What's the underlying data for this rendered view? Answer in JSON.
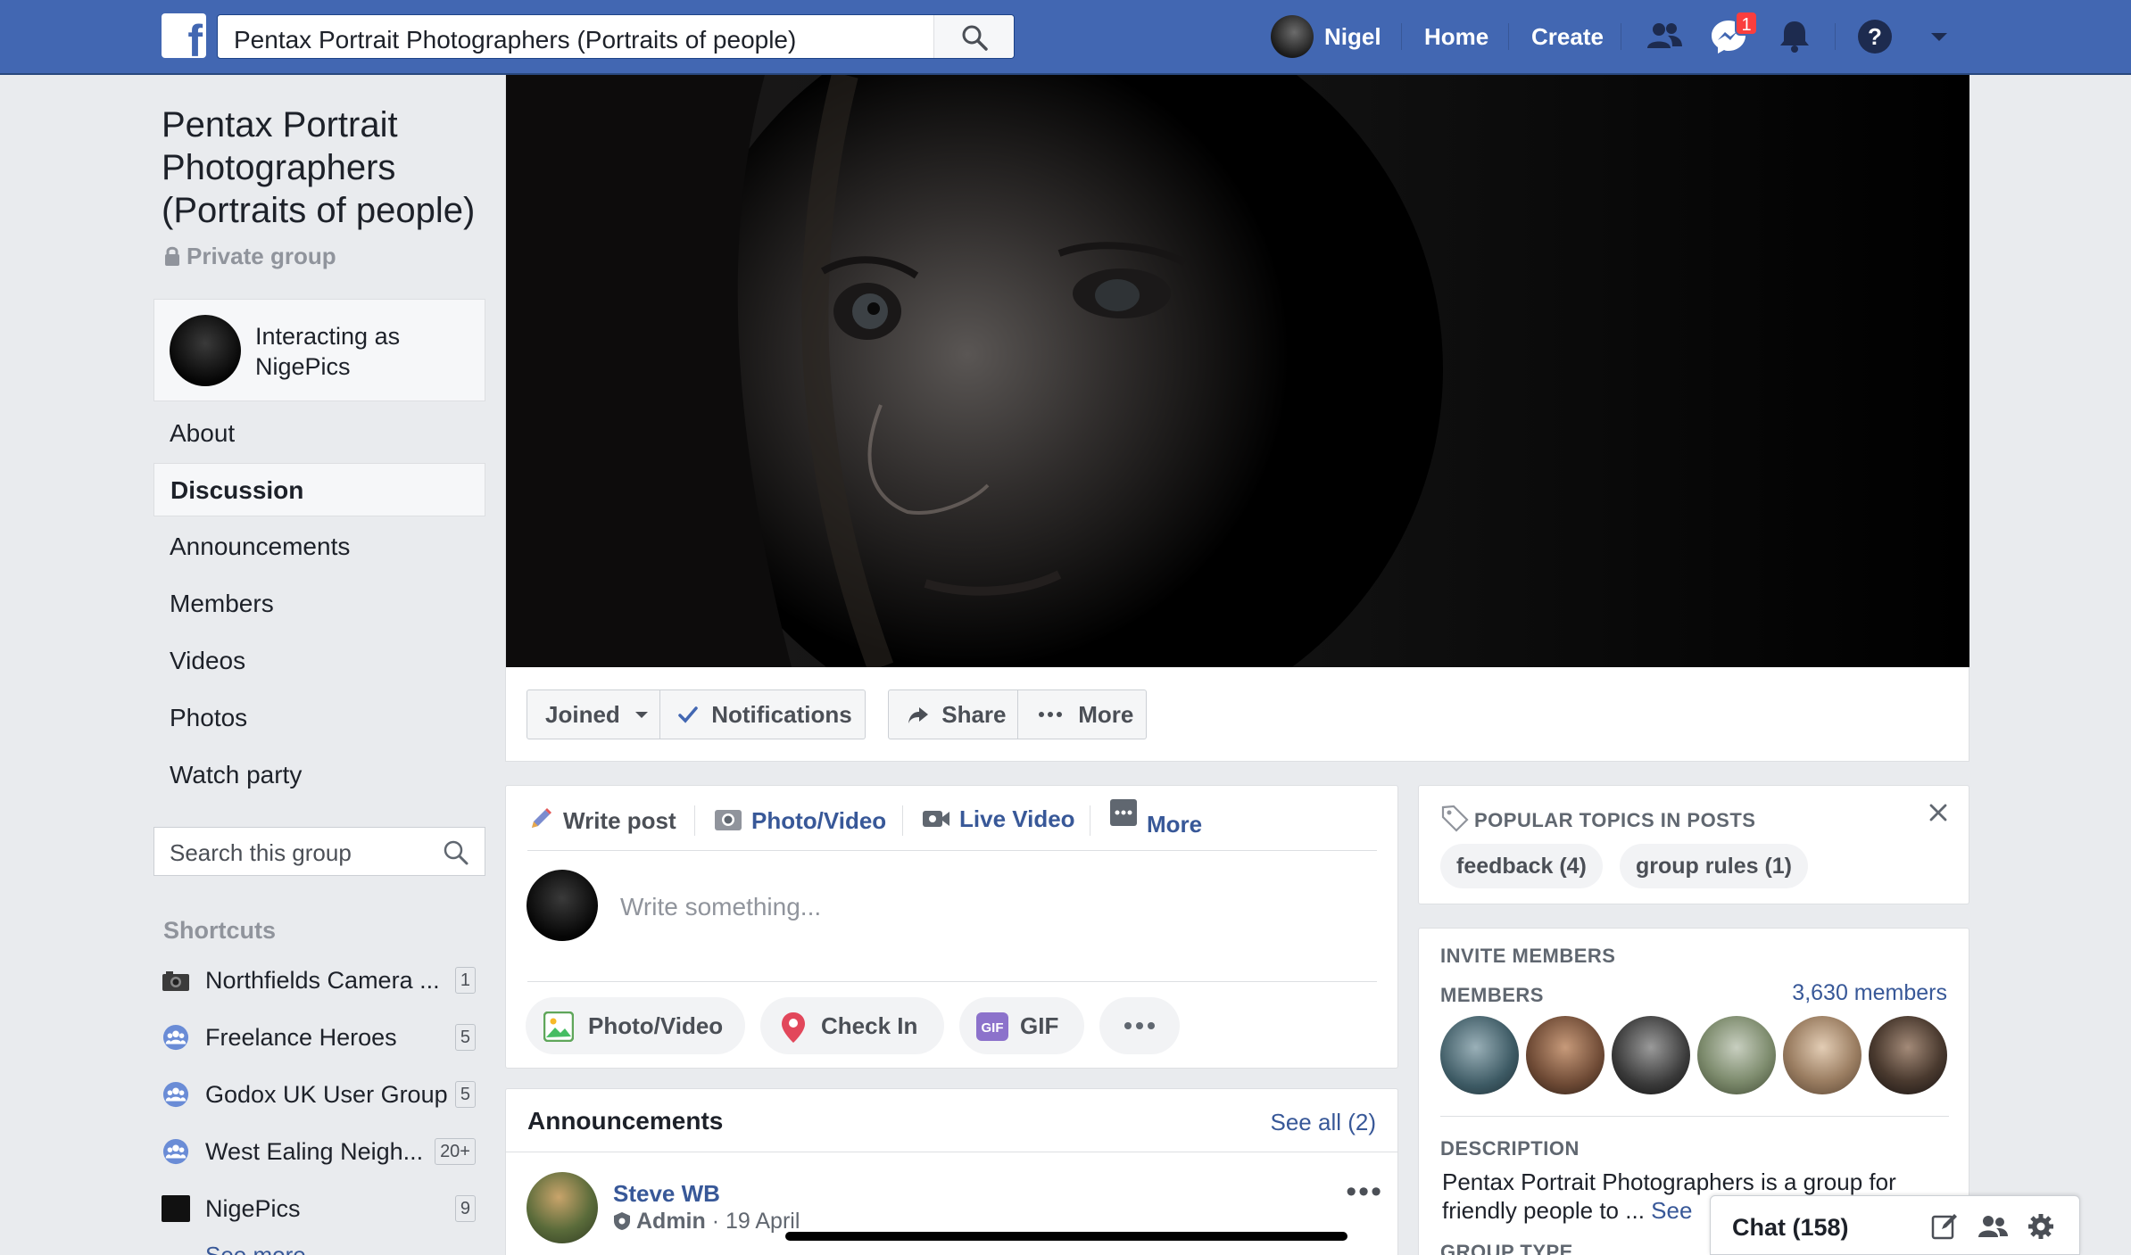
{
  "topbar": {
    "search_value": "Pentax Portrait Photographers (Portraits of people)",
    "user_name": "Nigel",
    "home_label": "Home",
    "create_label": "Create",
    "messages_badge": "1",
    "brand_color": "#4267b2"
  },
  "group": {
    "title": "Pentax Portrait Photographers (Portraits of people)",
    "privacy": "Private group",
    "interacting_as": "Interacting as NigePics"
  },
  "nav": {
    "items": [
      {
        "label": "About"
      },
      {
        "label": "Discussion"
      },
      {
        "label": "Announcements"
      },
      {
        "label": "Members"
      },
      {
        "label": "Videos"
      },
      {
        "label": "Photos"
      },
      {
        "label": "Watch party"
      }
    ],
    "active": "Discussion",
    "search_placeholder": "Search this group"
  },
  "shortcuts": {
    "heading": "Shortcuts",
    "items": [
      {
        "name": "Northfields Camera ...",
        "count": "1",
        "icon": "camera-icon"
      },
      {
        "name": "Freelance Heroes",
        "count": "5",
        "icon": "group-icon"
      },
      {
        "name": "Godox UK User Group",
        "count": "5",
        "icon": "group-icon"
      },
      {
        "name": "West Ealing Neigh...",
        "count": "20+",
        "icon": "group-icon"
      },
      {
        "name": "NigePics",
        "count": "9",
        "icon": "page-thumbnail"
      }
    ],
    "see_more": "See more"
  },
  "cover_actions": {
    "joined": "Joined",
    "notifications": "Notifications",
    "share": "Share",
    "more": "More"
  },
  "composer": {
    "tabs": [
      {
        "label": "Write post",
        "icon": "pencil-icon"
      },
      {
        "label": "Photo/Video",
        "icon": "camera-icon"
      },
      {
        "label": "Live Video",
        "icon": "video-camera-icon"
      },
      {
        "label": "More",
        "icon": "more-grid-icon"
      }
    ],
    "placeholder": "Write something...",
    "actions": [
      {
        "label": "Photo/Video",
        "icon": "photo-icon"
      },
      {
        "label": "Check In",
        "icon": "location-pin-icon"
      },
      {
        "label": "GIF",
        "icon": "gif-icon"
      }
    ]
  },
  "announcements": {
    "heading": "Announcements",
    "see_all": "See all (2)",
    "post": {
      "author": "Steve WB",
      "role": "Admin",
      "date": "· 19 April"
    }
  },
  "popular_topics": {
    "heading": "POPULAR TOPICS IN POSTS",
    "tags": [
      {
        "label": "feedback (4)"
      },
      {
        "label": "group rules (1)"
      }
    ]
  },
  "invite": {
    "heading": "INVITE MEMBERS",
    "members_label": "MEMBERS",
    "members_count": "3,630 members",
    "description_label": "DESCRIPTION",
    "description": "Pentax Portrait Photographers is a group for friendly people to ...",
    "see_more": "See",
    "group_type_label": "GROUP TYPE"
  },
  "chat": {
    "label": "Chat (158)"
  }
}
